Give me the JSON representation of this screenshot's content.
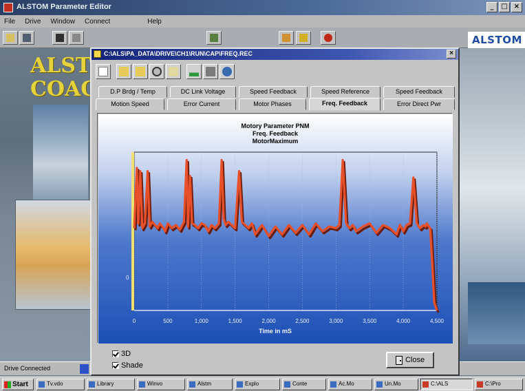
{
  "app": {
    "title": "ALSTOM Parameter Editor",
    "window_buttons": [
      "_",
      "□",
      "×"
    ],
    "menu": [
      "File",
      "Drive",
      "Window",
      "Connect",
      "Help"
    ],
    "logo_text": "ALSTOM",
    "background_text": [
      "ALSTOM",
      "COACH"
    ]
  },
  "dialog": {
    "title": "C:\\ALS\\PA_DATA\\DRIVE\\CH1\\RUN\\CAP\\FREQ.REC",
    "close_glyph": "×",
    "tabs_row1": [
      "D.P Brdg / Temp",
      "DC Link Voltage",
      "Speed Feedback",
      "Speed Reference",
      "Speed Feedback"
    ],
    "tabs_row2": [
      "Motion Speed",
      "Error Current",
      "Motor Phases",
      "Freq. Feedback",
      "Error Direct Pwr"
    ],
    "active_tab": "Freq. Feedback",
    "options": {
      "3d_label": "3D",
      "shade_label": "Shade"
    },
    "close_button_label": "Close"
  },
  "statusbar": {
    "text": "Drive Connected"
  },
  "taskbar": {
    "start_label": "Start",
    "tasks": [
      "Tv.vdo",
      "Library",
      "Winvo",
      "Alstm",
      "Explo",
      "Conte",
      "Ac.Mo",
      "Un.Mo",
      "C:\\ALS",
      "C:\\Pro"
    ]
  },
  "colors": {
    "plot_top": "#ffffff",
    "plot_bottom": "#1d4fb5",
    "series": "#e8502a",
    "dialog_title": "#1a2a84"
  },
  "chart_data": {
    "type": "line",
    "title": "Motory Parameter PNM",
    "subtitle": [
      "Freq. Feedback",
      "MotorMaximum"
    ],
    "xlabel": "Time in mS",
    "ylabel": "",
    "y_tick_label": "0",
    "xlim": [
      0,
      4500
    ],
    "ylim": [
      0,
      100
    ],
    "x_ticks": [
      "0",
      "500",
      "1,000",
      "1,500",
      "2,000",
      "2,500",
      "3,000",
      "3,500",
      "4,000",
      "4,500"
    ],
    "grid": true,
    "series": [
      {
        "x": [
          0,
          40,
          60,
          90,
          120,
          160,
          200,
          230,
          270,
          310,
          350,
          380,
          420,
          460,
          500,
          560,
          620,
          680,
          740,
          780,
          800,
          830,
          860,
          900,
          950,
          1000,
          1050,
          1100,
          1150,
          1200,
          1260,
          1300,
          1330,
          1360,
          1400,
          1450,
          1500,
          1560,
          1600,
          1650,
          1700,
          1750,
          1800,
          1900,
          2000,
          2100,
          2200,
          2300,
          2400,
          2500,
          2600,
          2700,
          2800,
          2900,
          3000,
          3050,
          3100,
          3150,
          3200,
          3250,
          3300,
          3400,
          3500,
          3600,
          3700,
          3800,
          3900,
          3950,
          4000,
          4050,
          4100,
          4150,
          4200,
          4250,
          4300,
          4330,
          4350,
          4380,
          4400,
          4430,
          4460,
          4500
        ],
        "y": [
          52,
          90,
          55,
          88,
          52,
          55,
          88,
          53,
          56,
          54,
          52,
          55,
          53,
          50,
          55,
          52,
          54,
          51,
          56,
          95,
          53,
          85,
          55,
          54,
          52,
          55,
          54,
          50,
          54,
          52,
          55,
          95,
          58,
          54,
          56,
          54,
          52,
          88,
          56,
          54,
          52,
          55,
          48,
          54,
          47,
          53,
          48,
          54,
          49,
          54,
          48,
          55,
          50,
          53,
          52,
          54,
          95,
          55,
          52,
          54,
          50,
          53,
          55,
          49,
          54,
          52,
          48,
          54,
          50,
          54,
          55,
          84,
          55,
          52,
          54,
          53,
          55,
          53,
          52,
          30,
          5,
          0
        ]
      }
    ]
  }
}
